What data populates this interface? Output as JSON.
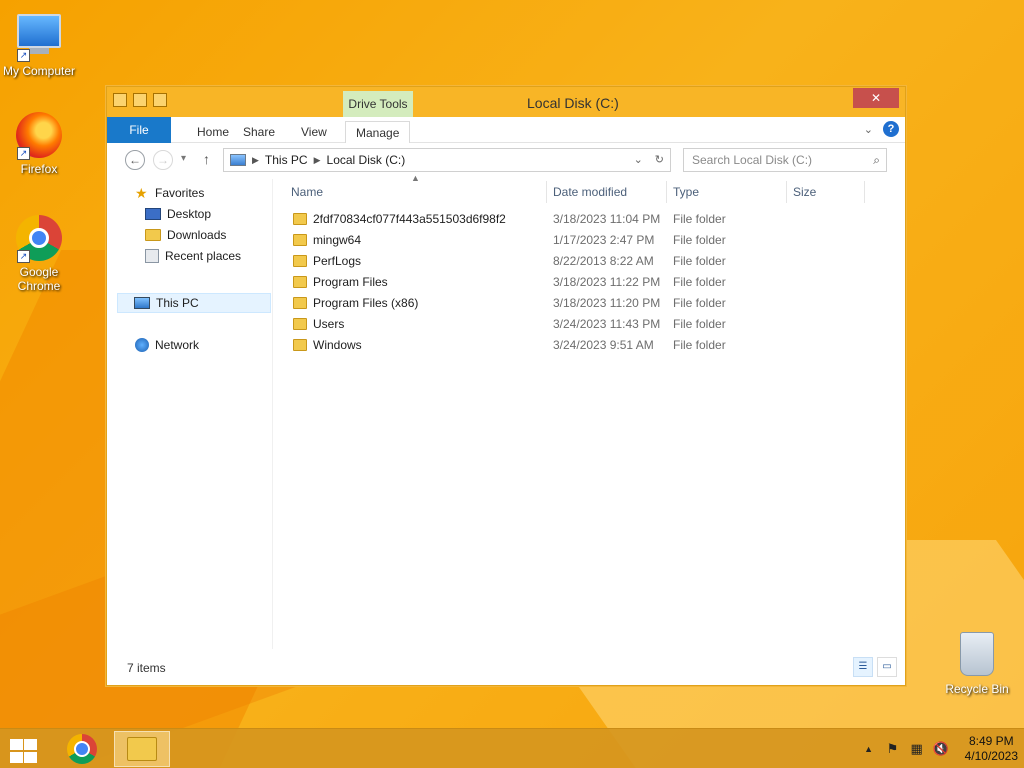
{
  "desktop": {
    "icons": [
      {
        "label": "My Computer",
        "icon": "computer-icon"
      },
      {
        "label": "Firefox",
        "icon": "firefox-icon"
      },
      {
        "label": "Google Chrome",
        "icon": "chrome-icon"
      },
      {
        "label": "Recycle Bin",
        "icon": "recycle-bin-icon"
      }
    ]
  },
  "window": {
    "title": "Local Disk (C:)",
    "contextual_tab_group": "Drive Tools",
    "close_glyph": "✕",
    "ribbon_tabs": [
      "File",
      "Home",
      "Share",
      "View",
      "Manage"
    ],
    "help_glyph": "?",
    "nav": {
      "back_glyph": "←",
      "forward_glyph": "→",
      "recent_glyph": "▾",
      "up_glyph": "↑"
    },
    "address": {
      "crumbs": [
        "This PC",
        "Local Disk (C:)"
      ],
      "separator": "▶",
      "dropdown_glyph": "⌄",
      "refresh_glyph": "↻"
    },
    "search": {
      "placeholder": "Search Local Disk (C:)",
      "icon_glyph": "⌕"
    },
    "nav_pane": {
      "favorites": "Favorites",
      "favorites_items": [
        "Desktop",
        "Downloads",
        "Recent places"
      ],
      "this_pc": "This PC",
      "network": "Network"
    },
    "columns": [
      "Name",
      "Date modified",
      "Type",
      "Size"
    ],
    "sort_glyph": "▲",
    "files": [
      {
        "name": "2fdf70834cf077f443a551503d6f98f2",
        "date": "3/18/2023 11:04 PM",
        "type": "File folder"
      },
      {
        "name": "mingw64",
        "date": "1/17/2023 2:47 PM",
        "type": "File folder"
      },
      {
        "name": "PerfLogs",
        "date": "8/22/2013 8:22 AM",
        "type": "File folder"
      },
      {
        "name": "Program Files",
        "date": "3/18/2023 11:22 PM",
        "type": "File folder"
      },
      {
        "name": "Program Files (x86)",
        "date": "3/18/2023 11:20 PM",
        "type": "File folder"
      },
      {
        "name": "Users",
        "date": "3/24/2023 11:43 PM",
        "type": "File folder"
      },
      {
        "name": "Windows",
        "date": "3/24/2023 9:51 AM",
        "type": "File folder"
      }
    ],
    "status": "7 items"
  },
  "taskbar": {
    "tray_up_glyph": "▲",
    "time": "8:49 PM",
    "date": "4/10/2023"
  },
  "colors": {
    "file_tab": "#1979ca",
    "close_button": "#c7504c",
    "desktop": "#f6a100"
  }
}
